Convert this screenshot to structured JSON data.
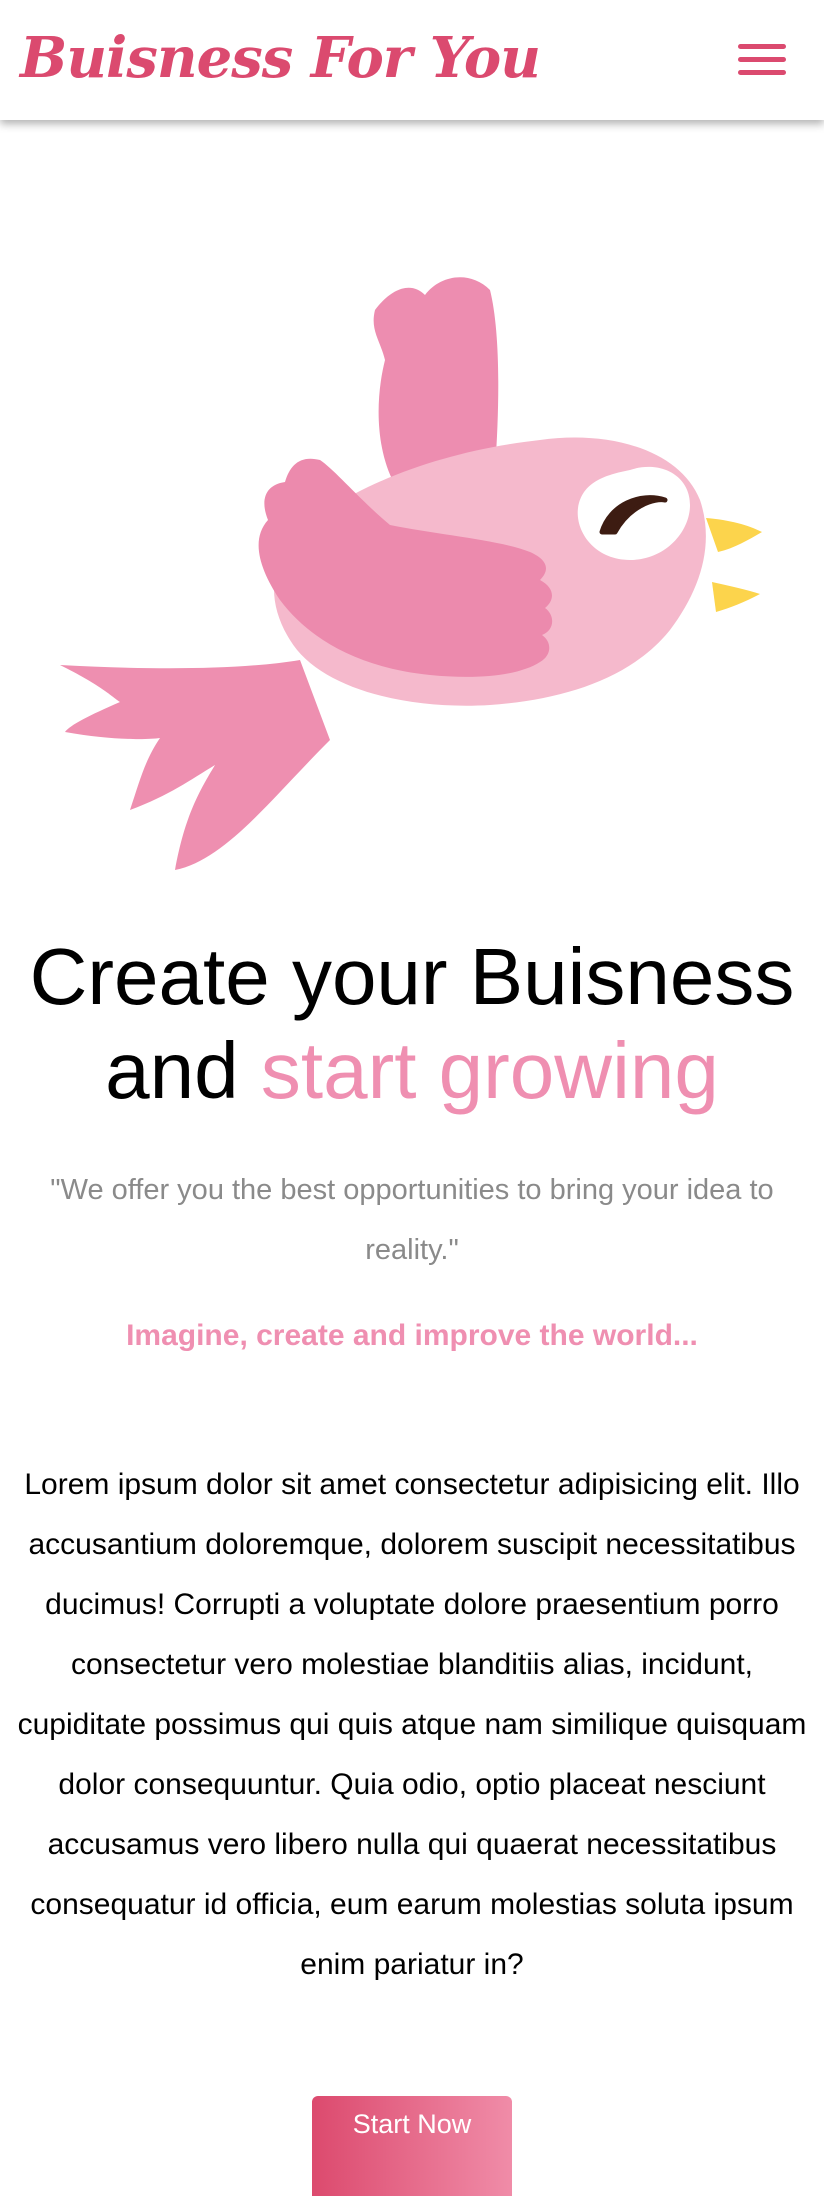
{
  "colors": {
    "brand": "#db4a6f",
    "accent_pink": "#ef8fb1",
    "muted_gray": "#8a8a8a",
    "button_gradient_start": "#dc4a6e",
    "button_gradient_end": "#f08ca8"
  },
  "header": {
    "brand_name": "Buisness For You",
    "menu_icon": "hamburger-menu-icon"
  },
  "hero": {
    "image": "pink-bird-illustration"
  },
  "headline": {
    "line1": "Create your Buisness",
    "line2_plain": "and ",
    "line2_accent": "start growing"
  },
  "quote": "\"We offer you the best opportunities to bring your idea to reality.\"",
  "tagline": "Imagine, create and improve the world...",
  "body": "Lorem ipsum dolor sit amet consectetur adipisicing elit. Illo accusantium doloremque, dolorem suscipit necessitatibus ducimus! Corrupti a voluptate dolore praesentium porro consectetur vero molestiae blanditiis alias, incidunt, cupiditate possimus qui quis atque nam similique quisquam dolor consequuntur. Quia odio, optio placeat nesciunt accusamus vero libero nulla qui quaerat necessitatibus consequatur id officia, eum earum molestias soluta ipsum enim pariatur in?",
  "cta": {
    "label": "Start Now"
  }
}
